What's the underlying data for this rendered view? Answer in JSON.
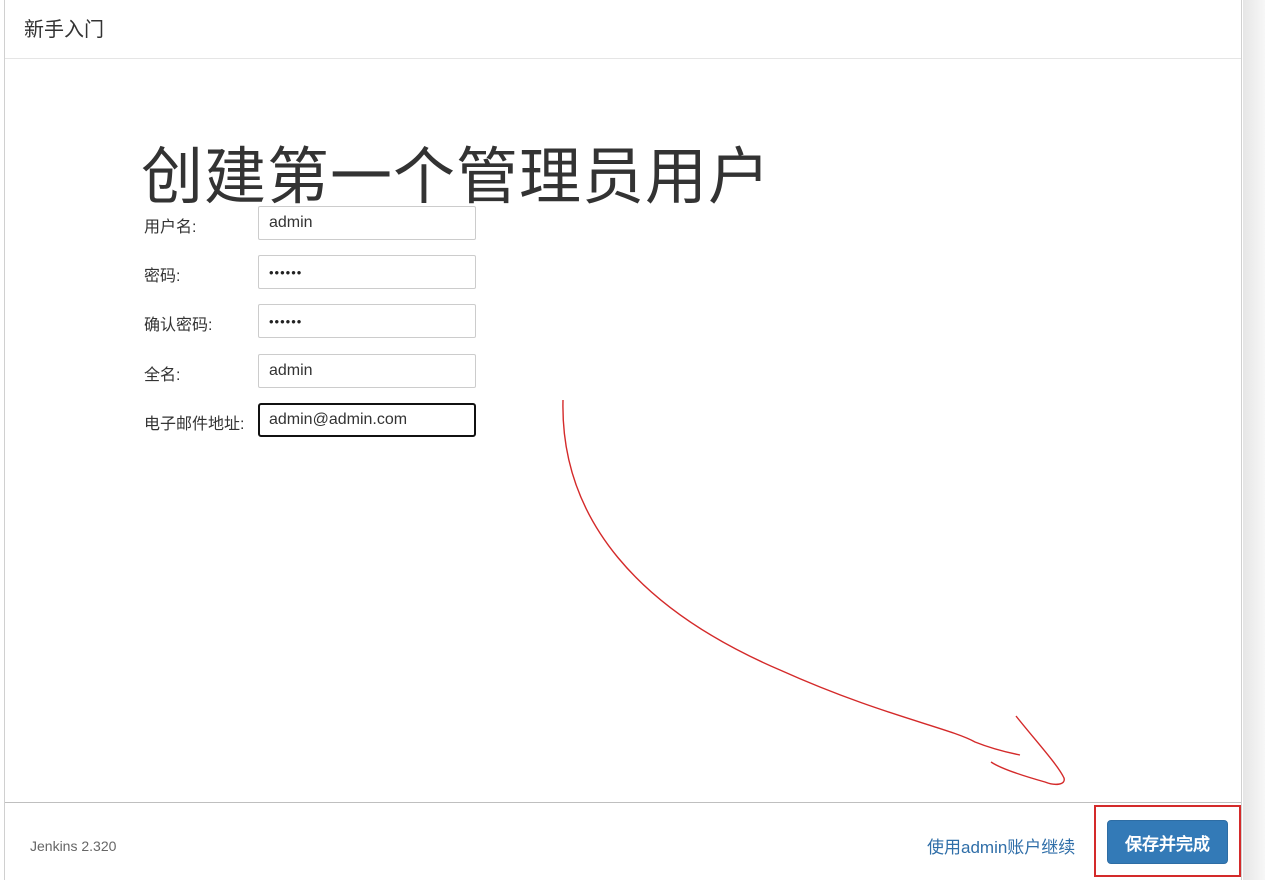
{
  "header": {
    "title": "新手入门"
  },
  "page": {
    "title": "创建第一个管理员用户"
  },
  "form": {
    "username": {
      "label": "用户名:",
      "value": "admin"
    },
    "password": {
      "label": "密码:",
      "value": "••••••"
    },
    "confirm_password": {
      "label": "确认密码:",
      "value": "••••••"
    },
    "fullname": {
      "label": "全名:",
      "value": "admin"
    },
    "email": {
      "label": "电子邮件地址:",
      "value": "admin@admin.com"
    }
  },
  "footer": {
    "version": "Jenkins 2.320",
    "skip_link": "使用admin账户继续",
    "save_button": "保存并完成"
  },
  "colors": {
    "primary_button": "#337ab7",
    "link": "#2f6ea8",
    "annotation_red": "#d42a2a"
  }
}
